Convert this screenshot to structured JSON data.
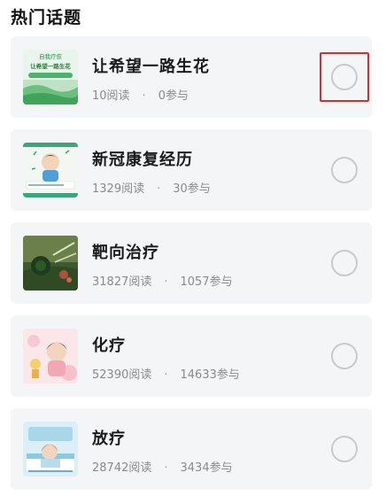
{
  "section": {
    "title": "热门话题"
  },
  "topics": [
    {
      "title": "让希望一路生花",
      "reads": "10阅读",
      "joins": "0参与",
      "thumb_lines": [
        "自我疗愈",
        "让希望一路生花"
      ]
    },
    {
      "title": "新冠康复经历",
      "reads": "1329阅读",
      "joins": "30参与"
    },
    {
      "title": "靶向治疗",
      "reads": "31827阅读",
      "joins": "1057参与"
    },
    {
      "title": "化疗",
      "reads": "52390阅读",
      "joins": "14633参与"
    },
    {
      "title": "放疗",
      "reads": "28742阅读",
      "joins": "3434参与"
    }
  ],
  "separator": "·",
  "colors": {
    "highlight": "#e02a2a",
    "card_bg": "#f4f5f7",
    "radio_border": "#c9c9c9"
  }
}
